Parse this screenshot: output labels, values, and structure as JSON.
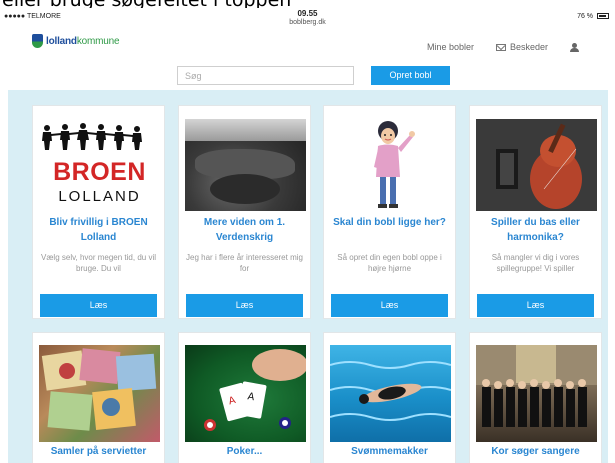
{
  "caption": "eller bruge søgefeltet i toppen",
  "status_bar": {
    "carrier": "●●●●● TELMORE",
    "time": "09.55",
    "host": "boblberg.dk",
    "battery": "76 %"
  },
  "header": {
    "logo_main": "lolland",
    "logo_suffix": "kommune",
    "nav": {
      "my_bubbles": "Mine bobler",
      "messages": "Beskeder"
    }
  },
  "search": {
    "placeholder": "Søg",
    "create_label": "Opret bobl"
  },
  "cards": [
    {
      "title": "Bliv frivillig i BROEN Lolland",
      "desc": "Vælg selv, hvor megen tid, du vil bruge. Du vil",
      "button": "Læs",
      "art_text_big": "BROEN",
      "art_text_small": "LOLLAND"
    },
    {
      "title": "Mere viden om 1. Verdenskrig",
      "desc": "Jeg har i flere år interesseret mig for",
      "button": "Læs"
    },
    {
      "title": "Skal din bobl ligge her?",
      "desc": "Så opret din egen bobl oppe i højre hjørne",
      "button": "Læs"
    },
    {
      "title": "Spiller du bas eller harmonika?",
      "desc": "Så mangler vi dig i vores spillegruppe! Vi spiller",
      "button": "Læs"
    },
    {
      "title": "Samler på servietter"
    },
    {
      "title": "Poker..."
    },
    {
      "title": "Svømmemakker"
    },
    {
      "title": "Kor søger sangere"
    }
  ],
  "colors": {
    "accent": "#1a9be6",
    "title_blue": "#2a86d1",
    "bg_light_blue": "#d9eef5",
    "logo_blue": "#1e4e9c",
    "logo_green": "#2f9a47",
    "broen_red": "#d32626"
  }
}
